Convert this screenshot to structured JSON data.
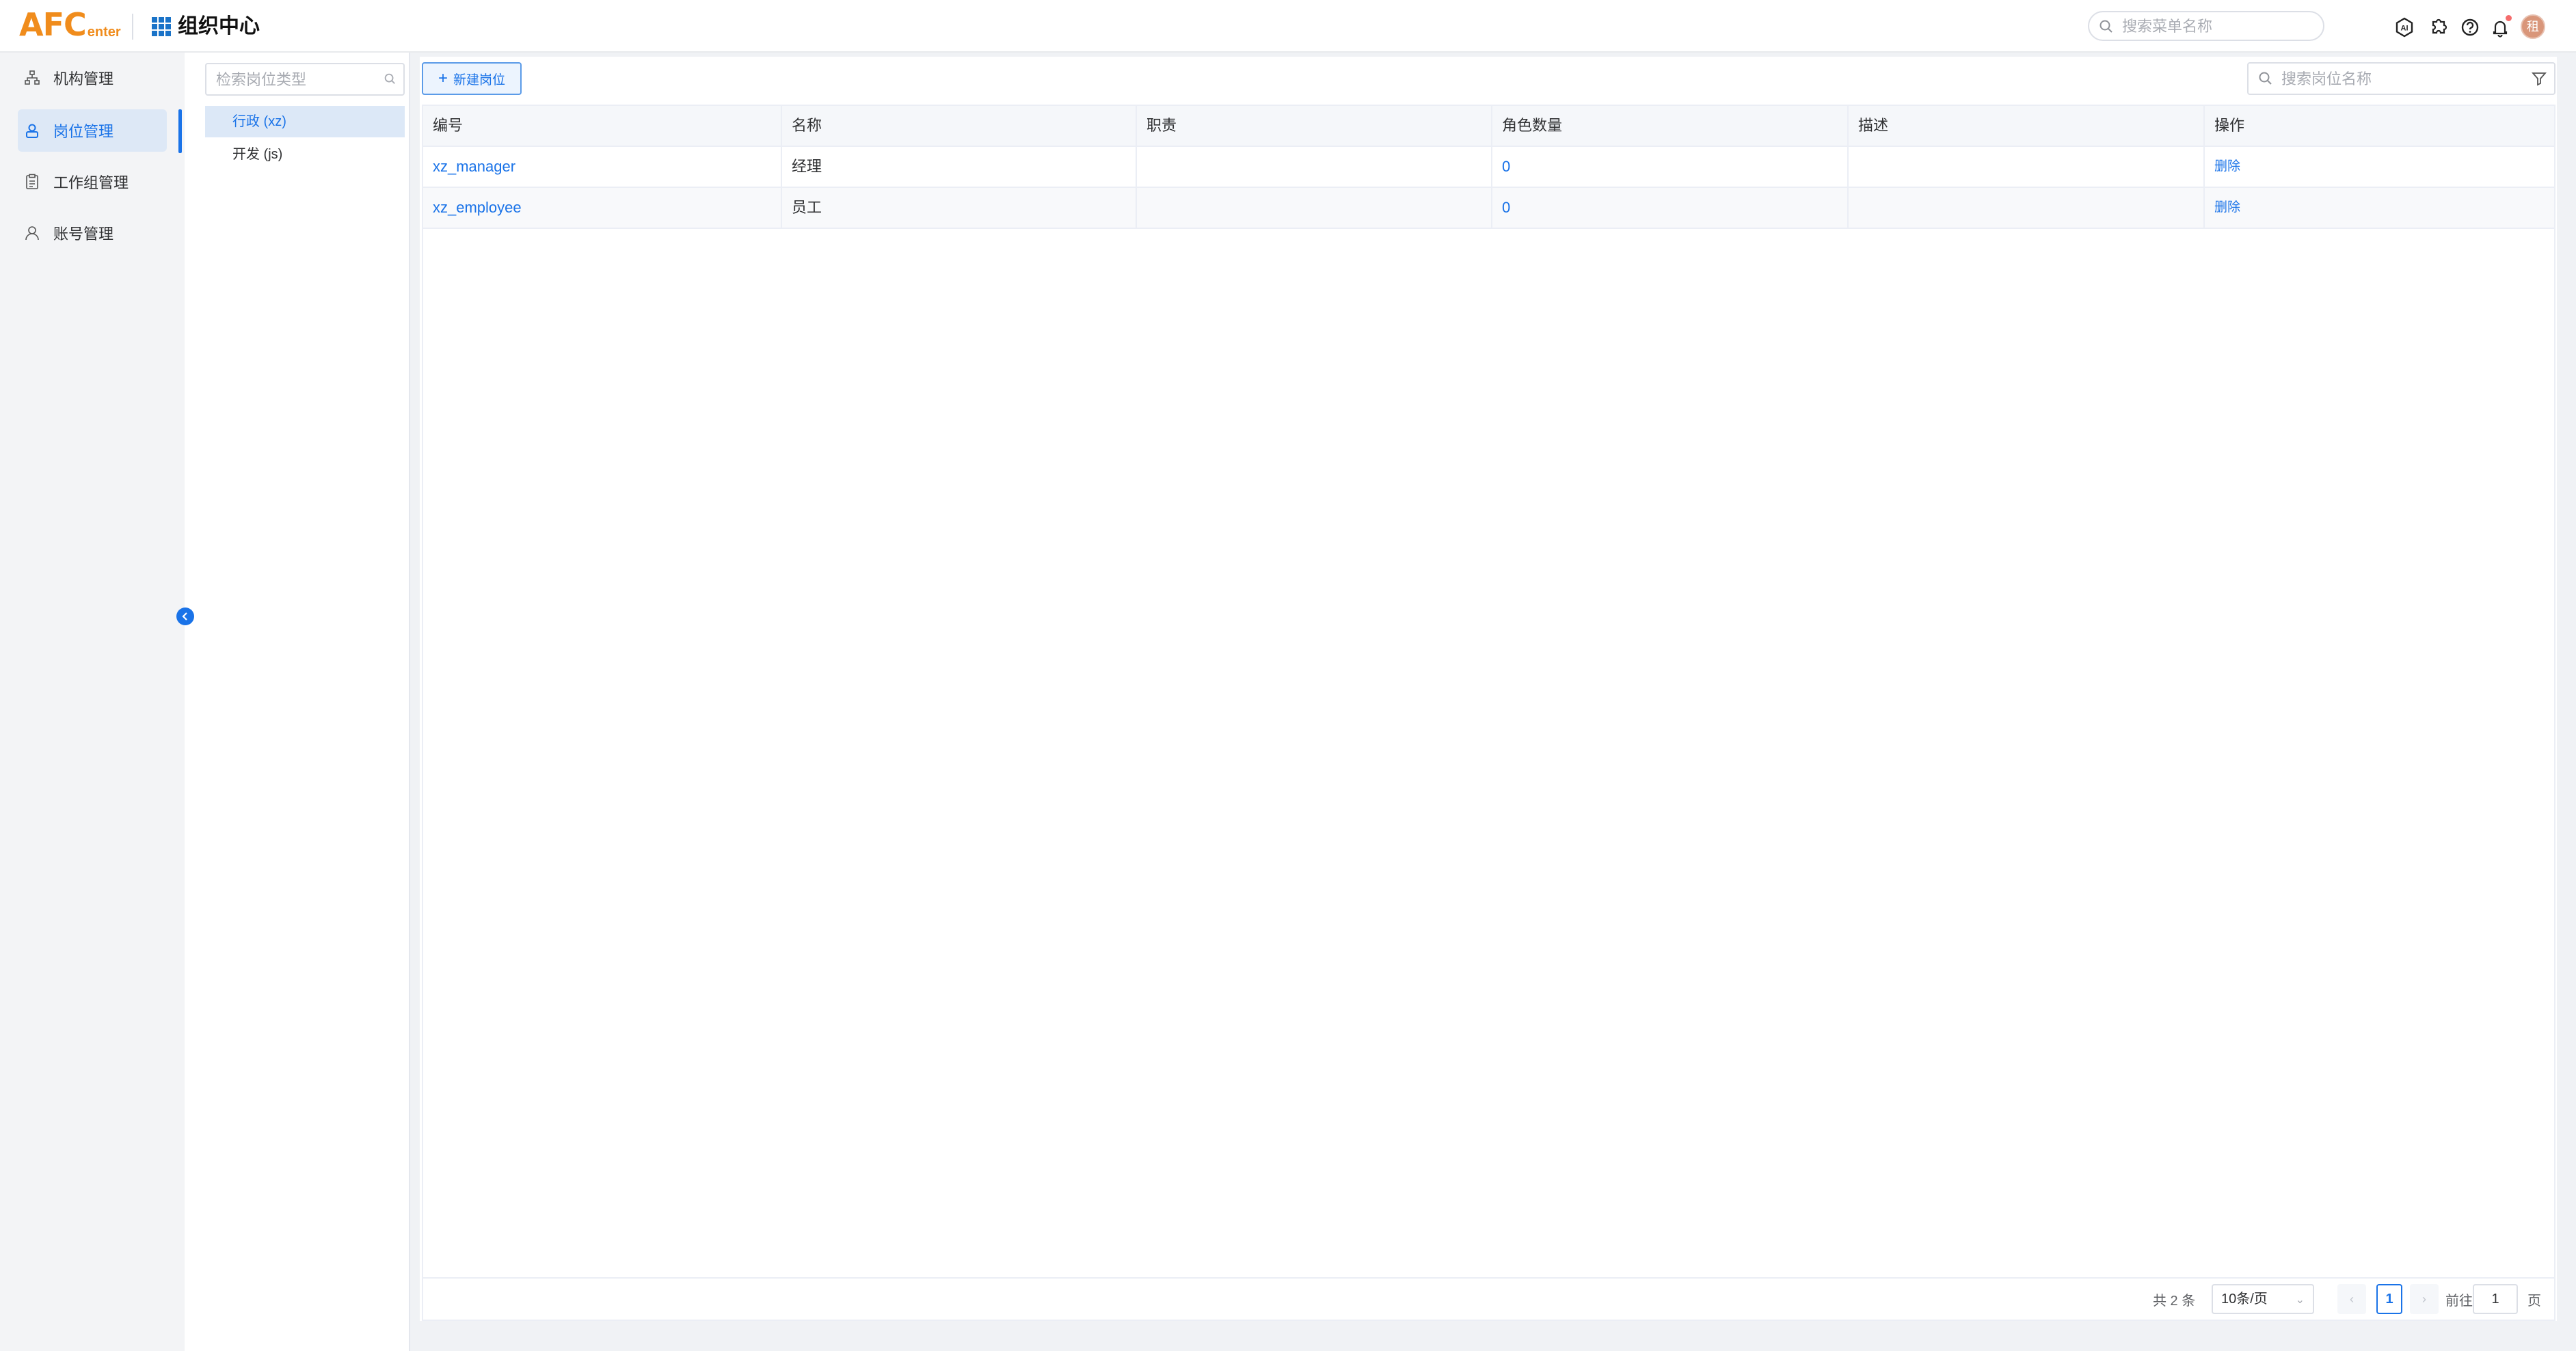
{
  "header": {
    "logo_main": "AFC",
    "logo_sub": "enter",
    "app_title": "组织中心",
    "menu_search_placeholder": "搜索菜单名称",
    "icons": [
      "ai-icon",
      "puzzle-icon",
      "help-icon",
      "bell-icon"
    ],
    "avatar_text": "租"
  },
  "nav": {
    "items": [
      {
        "label": "机构管理",
        "icon": "org-tree-icon",
        "active": false
      },
      {
        "label": "岗位管理",
        "icon": "user-badge-icon",
        "active": true
      },
      {
        "label": "工作组管理",
        "icon": "clipboard-icon",
        "active": false
      },
      {
        "label": "账号管理",
        "icon": "user-icon",
        "active": false
      }
    ]
  },
  "type_panel": {
    "search_placeholder": "检索岗位类型",
    "items": [
      {
        "label": "行政 (xz)",
        "active": true
      },
      {
        "label": "开发 (js)",
        "active": false
      }
    ]
  },
  "toolbar": {
    "new_button": "新建岗位",
    "search_placeholder": "搜索岗位名称"
  },
  "table": {
    "headers": [
      "编号",
      "名称",
      "职责",
      "角色数量",
      "描述",
      "操作"
    ],
    "rows": [
      {
        "code": "xz_manager",
        "name": "经理",
        "duty": "",
        "role_count": "0",
        "desc": "",
        "action": "删除"
      },
      {
        "code": "xz_employee",
        "name": "员工",
        "duty": "",
        "role_count": "0",
        "desc": "",
        "action": "删除"
      }
    ]
  },
  "pagination": {
    "total": "共 2 条",
    "page_size": "10条/页",
    "current_page": "1",
    "goto_prefix": "前往",
    "goto_value": "1",
    "goto_suffix": "页"
  },
  "colors": {
    "accent": "#1a73e8",
    "logo": "#f08c1c",
    "nav_active_bg": "#dde8f6"
  }
}
